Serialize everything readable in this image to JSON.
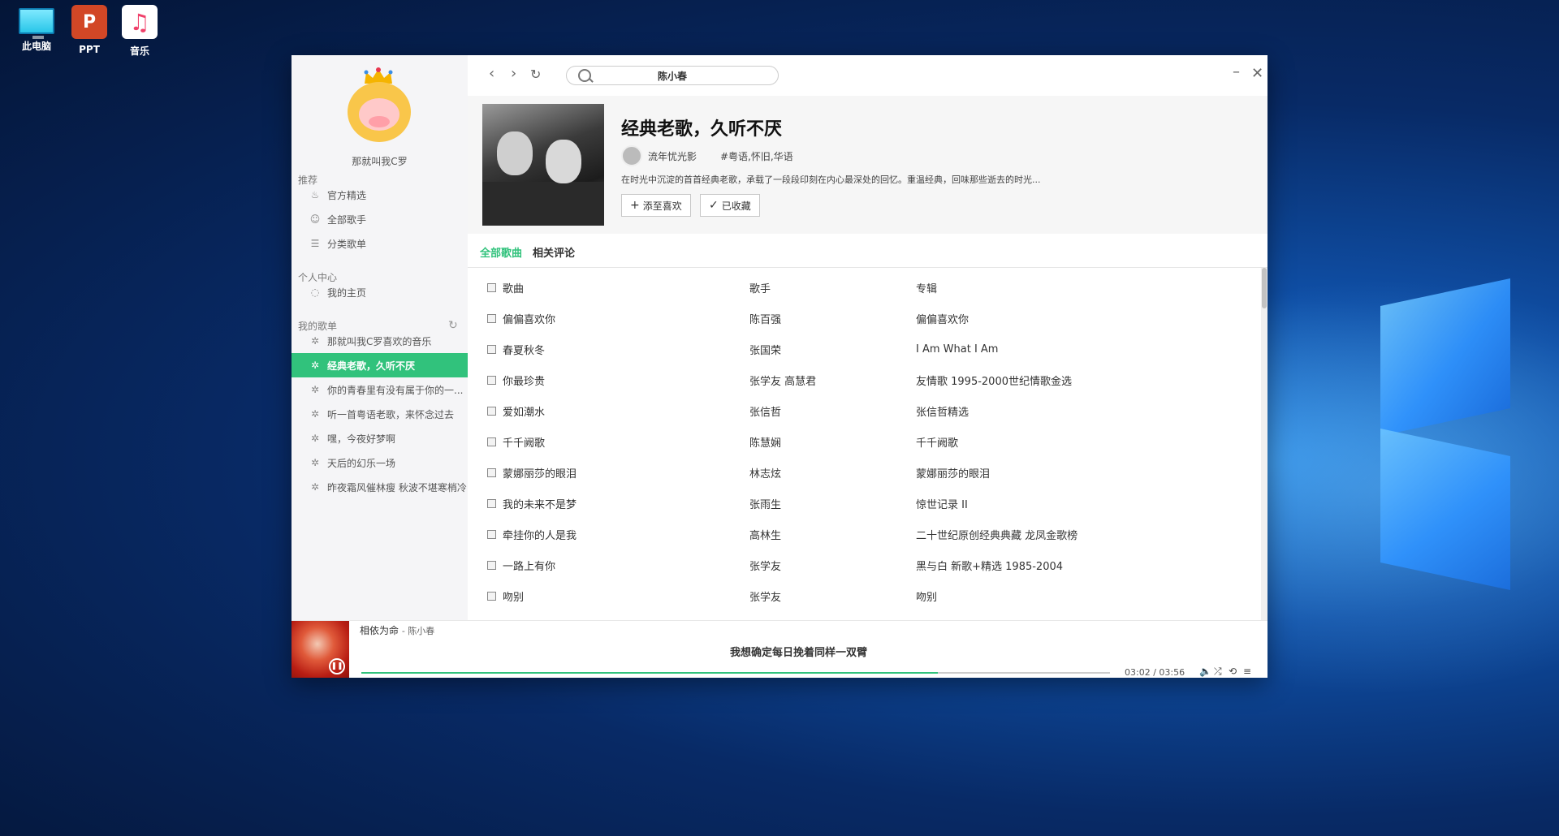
{
  "desktop": {
    "icons": [
      {
        "label": "此电脑",
        "icon": "computer-icon"
      },
      {
        "label": "PPT",
        "icon": "powerpoint-icon",
        "glyph": "P"
      },
      {
        "label": "音乐",
        "icon": "music-icon",
        "glyph": "♫"
      }
    ]
  },
  "sidebar": {
    "user_name": "那就叫我C罗",
    "sections": {
      "recommend": "推荐",
      "personal": "个人中心",
      "my_playlists": "我的歌单"
    },
    "recommend_items": [
      "官方精选",
      "全部歌手",
      "分类歌单"
    ],
    "personal_items": [
      "我的主页"
    ],
    "playlists": [
      "那就叫我C罗喜欢的音乐",
      "经典老歌，久听不厌",
      "你的青春里有没有属于你的一...",
      "听一首粤语老歌，来怀念过去",
      "嘿，今夜好梦啊",
      "天后的幻乐一场",
      "昨夜霜风催林瘦 秋波不堪寒梢冷"
    ],
    "active_playlist_index": 1
  },
  "topbar": {
    "search_value": "陈小春"
  },
  "playlist": {
    "title": "经典老歌，久听不厌",
    "creator": "流年忧光影",
    "tags": "#粤语,怀旧,华语",
    "description": "在时光中沉淀的首首经典老歌，承载了一段段印刻在内心最深处的回忆。重温经典，回味那些逝去的时光...",
    "add_favorite_label": "添至喜欢",
    "collected_label": "已收藏"
  },
  "tabs": [
    "全部歌曲",
    "相关评论"
  ],
  "song_table": {
    "headers": [
      "歌曲",
      "歌手",
      "专辑"
    ],
    "rows": [
      [
        "偏偏喜欢你",
        "陈百强",
        "偏偏喜欢你"
      ],
      [
        "春夏秋冬",
        "张国荣",
        "I Am What I Am"
      ],
      [
        "你最珍贵",
        "张学友 高慧君",
        "友情歌 1995-2000世纪情歌金选"
      ],
      [
        "爱如潮水",
        "张信哲",
        "张信哲精选"
      ],
      [
        "千千阙歌",
        "陈慧娴",
        "千千阙歌"
      ],
      [
        "蒙娜丽莎的眼泪",
        "林志炫",
        "蒙娜丽莎的眼泪"
      ],
      [
        "我的未来不是梦",
        "张雨生",
        "惊世记录 II"
      ],
      [
        "牵挂你的人是我",
        "高林生",
        "二十世纪原创经典典藏 龙凤金歌榜"
      ],
      [
        "一路上有你",
        "张学友",
        "黑与白 新歌+精选 1985-2004"
      ],
      [
        "吻别",
        "张学友",
        "吻别"
      ]
    ]
  },
  "player": {
    "song_title": "相依为命",
    "artist": "陈小春",
    "lyric": "我想确定每日挽着同样一双臂",
    "time": "03:02 / 03:56",
    "progress_fraction": 0.77,
    "accent_color": "#31c27c"
  }
}
